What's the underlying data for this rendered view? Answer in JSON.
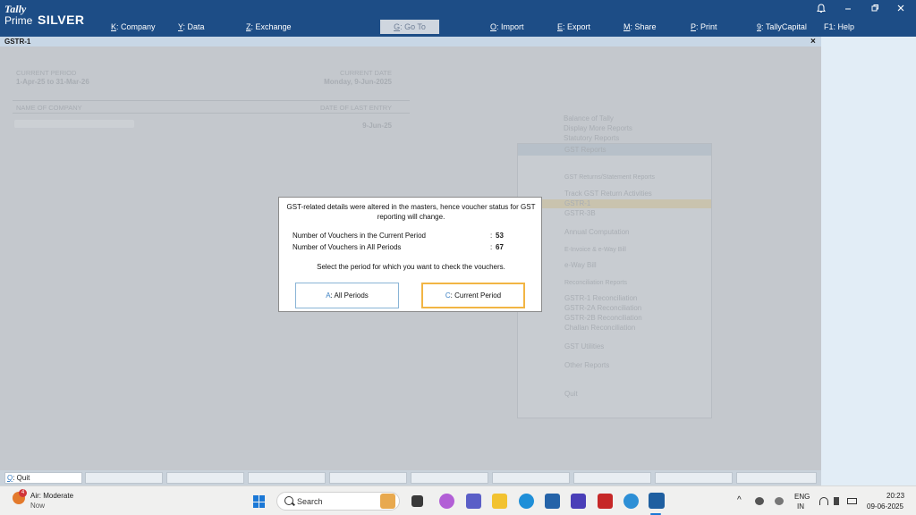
{
  "app": {
    "logo_tally": "Tally",
    "logo_prime": "Prime",
    "edition": "SILVER"
  },
  "menu": [
    {
      "key": "K",
      "label": ": Company"
    },
    {
      "key": "Y",
      "label": ": Data"
    },
    {
      "key": "Z",
      "label": ": Exchange"
    },
    {
      "key": "O",
      "label": ": Import"
    },
    {
      "key": "E",
      "label": ": Export"
    },
    {
      "key": "M",
      "label": ": Share"
    },
    {
      "key": "P",
      "label": ": Print"
    },
    {
      "key": "9",
      "label": ": TallyCapital"
    },
    {
      "key": "F1",
      "label": ": Help"
    }
  ],
  "goto": {
    "key": "G",
    "label": ": Go To"
  },
  "window_title": "GSTR-1",
  "background": {
    "current_period_label": "CURRENT PERIOD",
    "current_period_value": "1-Apr-25 to 31-Mar-26",
    "current_date_label": "CURRENT DATE",
    "current_date_value": "Monday, 9-Jun-2025",
    "name_of_company_label": "NAME OF COMPANY",
    "date_of_last_entry_label": "DATE OF LAST ENTRY",
    "date_of_last_entry_value": "9-Jun-25"
  },
  "goto_panel": {
    "items": [
      "Balance of Tally",
      "Display More Reports",
      "Statutory Reports",
      "GST Reports"
    ],
    "group1_title": "GST Returns/Statement Reports",
    "group1_items": [
      "Track GST Return Activities",
      "GSTR-1",
      "GSTR-3B"
    ],
    "annual": "Annual Computation",
    "ewaybill_title": "E-Invoice & e-Way Bill",
    "ewaybill_item": "e-Way Bill",
    "recon_title": "Reconciliation Reports",
    "recon_items": [
      "GSTR-1 Reconciliation",
      "GSTR-2A Reconciliation",
      "GSTR-2B Reconciliation",
      "Challan Reconciliation"
    ],
    "utilities": "GST Utilities",
    "other_reports": "Other Reports",
    "quit": "Quit"
  },
  "dialog": {
    "message": "GST-related details were altered in the masters, hence voucher status for GST reporting will change.",
    "rows": [
      {
        "label": "Number of Vouchers in the Current Period",
        "value": "53"
      },
      {
        "label": "Number of Vouchers in All Periods",
        "value": "67"
      }
    ],
    "prompt": "Select the period for which you want to check the vouchers.",
    "btn_all_key": "A",
    "btn_all_label": ": All Periods",
    "btn_current_key": "C",
    "btn_current_label": ": Current Period"
  },
  "bottom_bar": {
    "quit_key": "Q",
    "quit_label": ": Quit"
  },
  "taskbar": {
    "weather_badge": "4",
    "weather_text": "Air: Moderate",
    "weather_sub": "Now",
    "search_placeholder": "Search",
    "lang_top": "ENG",
    "lang_bottom": "IN",
    "time": "20:23",
    "date": "09-06-2025"
  },
  "colors": {
    "topbar": "#1d4d86",
    "accent_key": "#3b7fc2",
    "highlight_button": "#f2b544"
  }
}
